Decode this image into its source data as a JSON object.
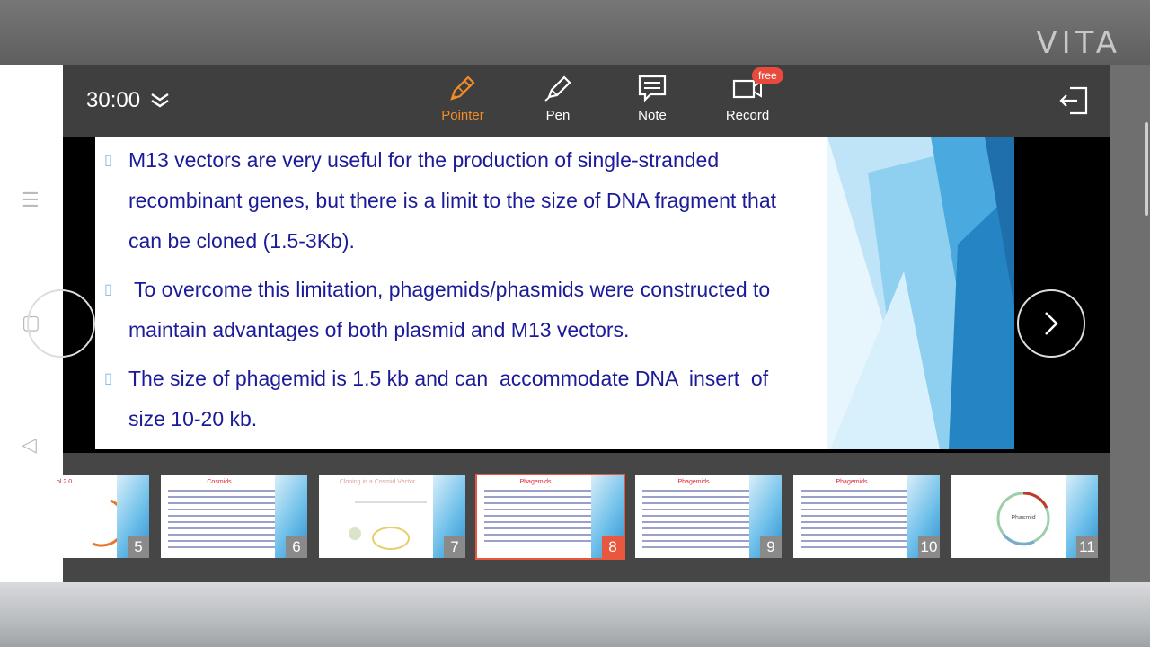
{
  "watermark": "VITA",
  "toolbar": {
    "timer": "30:00",
    "tools": [
      {
        "label": "Pointer",
        "icon": "pointer-pen-icon",
        "active": true
      },
      {
        "label": "Pen",
        "icon": "pen-icon",
        "active": false
      },
      {
        "label": "Note",
        "icon": "note-icon",
        "active": false
      },
      {
        "label": "Record",
        "icon": "video-record-icon",
        "active": false,
        "badge": "free"
      }
    ],
    "exit_icon": "exit-icon",
    "accent_color": "#f28c28"
  },
  "slide": {
    "bullets": [
      {
        "lines": [
          "M13 vectors are very useful for the production of single-stranded",
          "recombinant genes, but there is a limit to the size of DNA fragment that",
          "can be cloned (1.5-3Kb)."
        ]
      },
      {
        "lines": [
          " To overcome this limitation, phagemids/phasmids were constructed to",
          "maintain advantages of both plasmid and M13 vectors."
        ]
      },
      {
        "lines": [
          "The size of phagemid is 1.5 kb and can  accommodate DNA  insert  of",
          "size 10-20 kb."
        ]
      }
    ],
    "text_color": "#1b1b9a"
  },
  "thumbnails": [
    {
      "number": "5",
      "title": "ol 2.0"
    },
    {
      "number": "6",
      "title": "Cosmids"
    },
    {
      "number": "7",
      "title": "Cloning in a Cosmid Vector"
    },
    {
      "number": "8",
      "title": "Phagemids",
      "selected": true
    },
    {
      "number": "9",
      "title": "Phagemids"
    },
    {
      "number": "10",
      "title": "Phagemids"
    },
    {
      "number": "11",
      "title": "Phasmid"
    }
  ]
}
